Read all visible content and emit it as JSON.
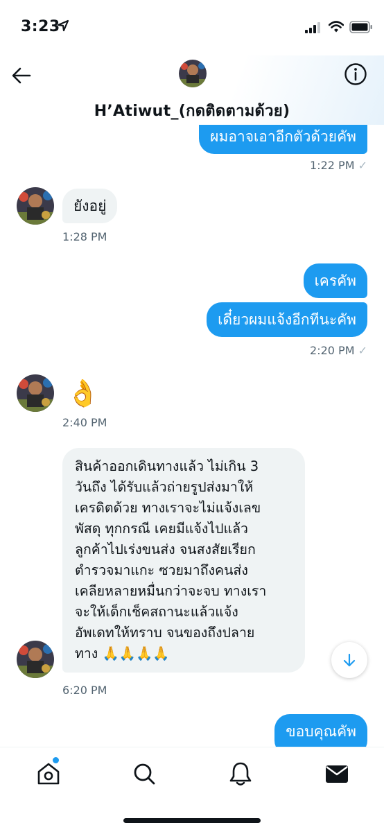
{
  "status_bar": {
    "time": "3:23"
  },
  "header": {
    "contact_name": "H’Atiwut_(กดติดตามด้วย)"
  },
  "messages": [
    {
      "text": "ผมอาจเอาอีกตัวด้วยคัพ",
      "time": "1:22 PM"
    },
    {
      "text": "ยังอยู่",
      "time": "1:28 PM"
    },
    {
      "text": "เครคัพ"
    },
    {
      "text": "เดี๋ยวผมแจ้งอีกทีนะคัพ",
      "time": "2:20 PM"
    },
    {
      "text": "👌",
      "time": "2:40 PM"
    },
    {
      "lines": [
        "สินค้าออกเดินทางแล้ว ไม่เกิน 3",
        "วันถึง ได้รับแล้วถ่ายรูปส่งมาให้",
        "เครดิตด้วย ทางเราจะไม่แจ้งเลข",
        "พัสดุ ทุกกรณี เคยมีแจ้งไปแล้ว",
        "ลูกค้าไปเร่งขนส่ง จนสงสัยเรียก",
        "ตำรวจมาแกะ ซวยมาถึงคนส่ง",
        "เคลียหลายหมื่นกว่าจะจบ ทางเรา",
        "จะให้เด็กเช็คสถานะแล้วแจ้ง",
        "อัพเดทให้ทราบ จนของถึงปลาย",
        "ทาง 🙏🙏🙏🙏"
      ],
      "time": "6:20 PM"
    },
    {
      "text": "ขอบคุณคัพ"
    }
  ],
  "read_mark": "✓",
  "icons": {
    "back": "back-arrow-icon",
    "info": "info-icon",
    "scroll_down": "arrow-down-icon",
    "home": "home-icon",
    "search": "search-icon",
    "notifications": "bell-icon",
    "messages": "mail-icon"
  },
  "colors": {
    "accent": "#1d9bf0",
    "incoming_bubble": "#eff3f4",
    "text": "#0f1419",
    "muted": "#536471"
  }
}
